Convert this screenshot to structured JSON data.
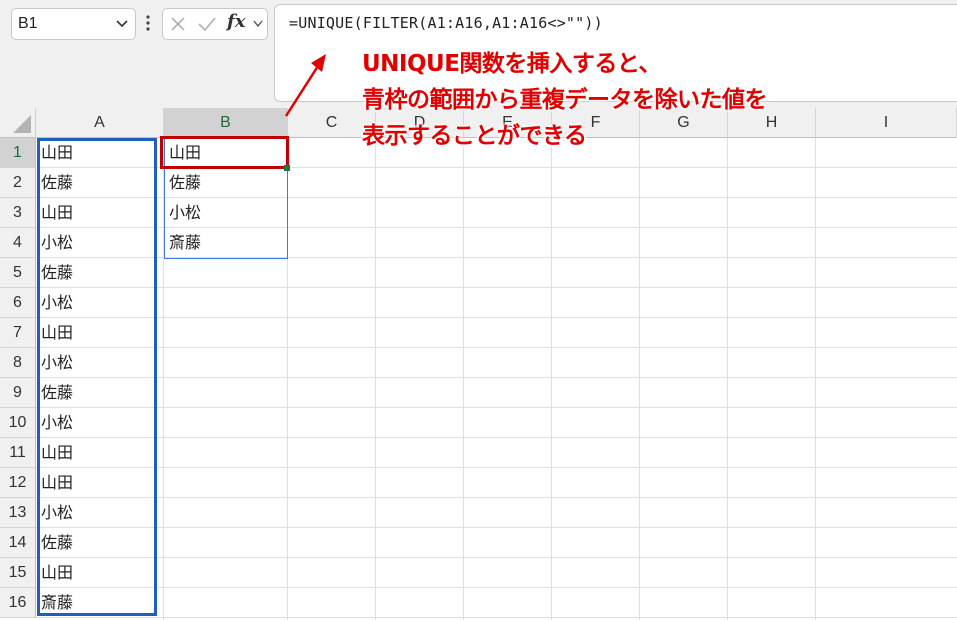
{
  "name_box": {
    "value": "B1"
  },
  "formula_bar": {
    "cancel_icon": "x-icon",
    "enter_icon": "check-icon",
    "function_label": "fx",
    "formula": "=UNIQUE(FILTER(A1:A16,A1:A16<>\"\"))"
  },
  "columns": [
    "A",
    "B",
    "C",
    "D",
    "E",
    "F",
    "G",
    "H",
    "I"
  ],
  "rows": [
    "1",
    "2",
    "3",
    "4",
    "5",
    "6",
    "7",
    "8",
    "9",
    "10",
    "11",
    "12",
    "13",
    "14",
    "15",
    "16"
  ],
  "column_a": [
    "山田",
    "佐藤",
    "山田",
    "小松",
    "佐藤",
    "小松",
    "山田",
    "小松",
    "佐藤",
    "小松",
    "山田",
    "山田",
    "小松",
    "佐藤",
    "山田",
    "斎藤"
  ],
  "column_b": [
    "山田",
    "佐藤",
    "小松",
    "斎藤"
  ],
  "annotation": {
    "line1": "UNIQUE関数を挿入すると、",
    "line2": "青枠の範囲から重複データを除いた値を",
    "line3": "表示することができる",
    "color": "#e00000"
  },
  "colors": {
    "highlight_blue": "#1f5fbf",
    "highlight_red": "#c00000",
    "excel_green": "#217346"
  }
}
